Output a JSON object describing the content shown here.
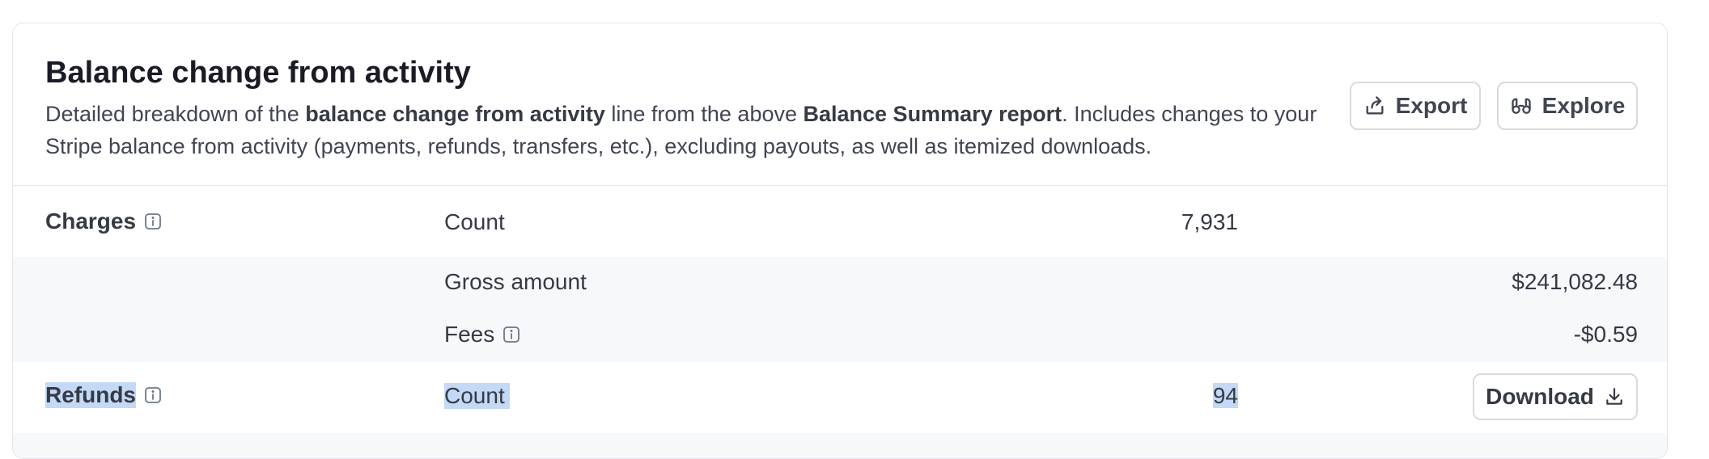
{
  "section": {
    "title": "Balance change from activity",
    "desc_1": "Detailed breakdown of the ",
    "desc_2": "balance change from activity",
    "desc_3": " line from the above ",
    "desc_4": "Balance Summary report",
    "desc_5": ". Includes changes to your Stripe balance from activity (payments, refunds, transfers, etc.), excluding payouts, as well as itemized downloads.",
    "export_label": "Export",
    "explore_label": "Explore"
  },
  "charges": {
    "label": "Charges",
    "count_label": "Count",
    "count_value": "7,931",
    "gross_label": "Gross amount",
    "gross_value": "$241,082.48",
    "fees_label": "Fees",
    "fees_value": "-$0.59"
  },
  "refunds": {
    "label": "Refunds",
    "count_label": "Count",
    "count_value": "94",
    "download_label": "Download"
  },
  "icons": {
    "info": "info-icon",
    "export": "export-icon",
    "explore": "binoculars-icon",
    "download": "download-icon"
  }
}
